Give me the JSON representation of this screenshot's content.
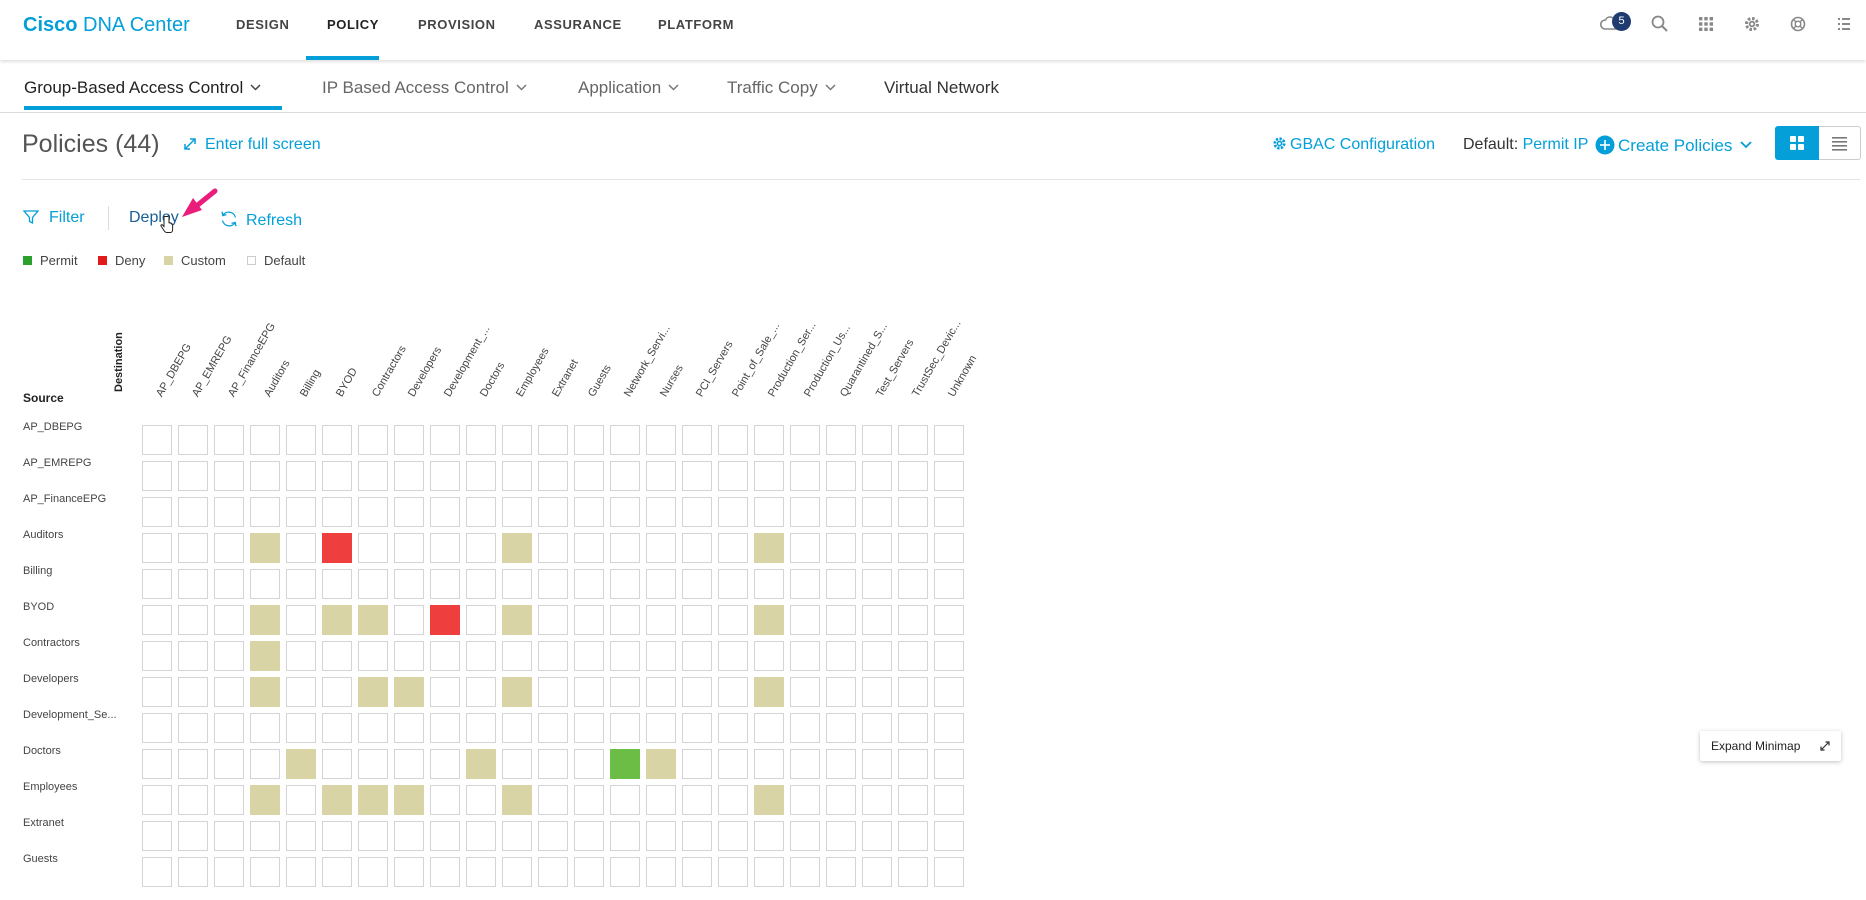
{
  "brand": {
    "cisco": "Cisco",
    "product": "DNA Center"
  },
  "nav": [
    {
      "label": "DESIGN"
    },
    {
      "label": "POLICY",
      "active": true
    },
    {
      "label": "PROVISION"
    },
    {
      "label": "ASSURANCE"
    },
    {
      "label": "PLATFORM"
    }
  ],
  "header_icons": {
    "notifications_count": "5"
  },
  "subnav": [
    {
      "label": "Group-Based Access Control",
      "has_caret": true,
      "active": true
    },
    {
      "label": "IP Based Access Control",
      "has_caret": true
    },
    {
      "label": "Application",
      "has_caret": true
    },
    {
      "label": "Traffic Copy",
      "has_caret": true
    },
    {
      "label": "Virtual Network",
      "has_caret": false
    }
  ],
  "page": {
    "title": "Policies (44)",
    "fullscreen_label": "Enter full screen",
    "gbac_label": "GBAC Configuration",
    "default_label": "Default:",
    "default_value": "Permit IP",
    "create_label": "Create Policies"
  },
  "toolbar": {
    "filter": "Filter",
    "deploy": "Deploy",
    "refresh": "Refresh"
  },
  "legend": [
    {
      "label": "Permit",
      "color": "#2ca02c"
    },
    {
      "label": "Deny",
      "color": "#e31a1c"
    },
    {
      "label": "Custom",
      "color": "#d9d4a5"
    },
    {
      "label": "Default",
      "color": "#ffffff"
    }
  ],
  "colors": {
    "accent": "#049fd9",
    "permit": "#6cbd45",
    "deny": "#ee3e3e",
    "custom": "#d9d4a5"
  },
  "matrix": {
    "destination_label": "Destination",
    "source_label": "Source",
    "columns": [
      "AP_DBEPG",
      "AP_EMREPG",
      "AP_FinanceEPG",
      "Auditors",
      "Billing",
      "BYOD",
      "Contractors",
      "Developers",
      "Development_...",
      "Doctors",
      "Employees",
      "Extranet",
      "Guests",
      "Network_Servi...",
      "Nurses",
      "PCI_Servers",
      "Point_of_Sale_...",
      "Production_Ser...",
      "Production_Us...",
      "Quarantined_S...",
      "Test_Servers",
      "TrustSec_Devic...",
      "Unknown"
    ],
    "rows": [
      {
        "label": "AP_DBEPG",
        "cells": "......................."
      },
      {
        "label": "AP_EMREPG",
        "cells": "......................."
      },
      {
        "label": "AP_FinanceEPG",
        "cells": "......................."
      },
      {
        "label": "Auditors",
        "cells": "...C.D....C......C....."
      },
      {
        "label": "Billing",
        "cells": "......................."
      },
      {
        "label": "BYOD",
        "cells": "...C.CC.D.C......C....."
      },
      {
        "label": "Contractors",
        "cells": "...C..................."
      },
      {
        "label": "Developers",
        "cells": "...C..CC..C......C....."
      },
      {
        "label": "Development_Se...",
        "cells": "......................."
      },
      {
        "label": "Doctors",
        "cells": "....C....C...PC........"
      },
      {
        "label": "Employees",
        "cells": "...C.CCC..C......C....."
      },
      {
        "label": "Extranet",
        "cells": "......................."
      },
      {
        "label": "Guests",
        "cells": "......................."
      }
    ]
  },
  "minimap": {
    "label": "Expand Minimap"
  }
}
